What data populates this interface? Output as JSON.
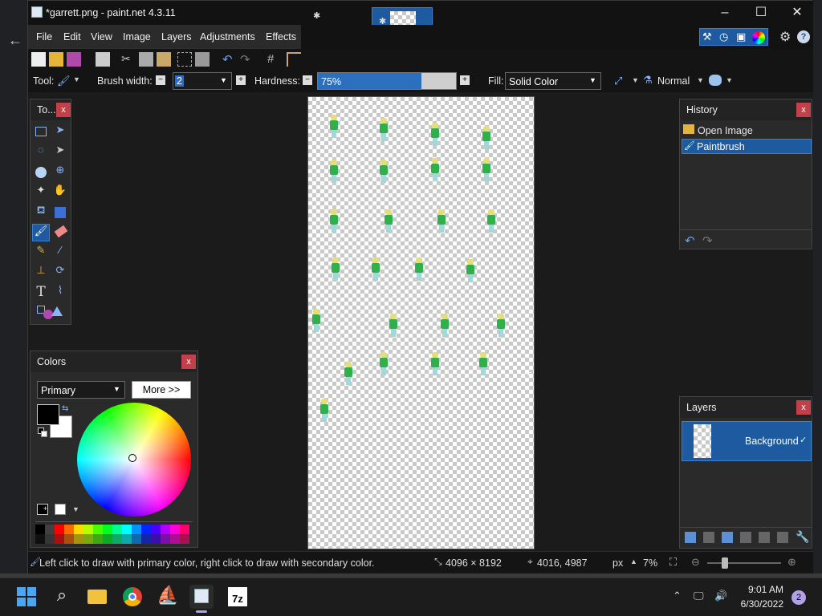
{
  "window": {
    "title": "*garrett.png - paint.net 4.3.11"
  },
  "menu": {
    "items": [
      "File",
      "Edit",
      "View",
      "Image",
      "Layers",
      "Adjustments",
      "Effects"
    ]
  },
  "toolbar": {
    "tool_label": "Tool:",
    "brush_width_label": "Brush width:",
    "brush_width_value": "2",
    "hardness_label": "Hardness:",
    "hardness_value": "75%",
    "hardness_fraction": 0.75,
    "fill_label": "Fill:",
    "fill_value": "Solid Color",
    "blend_mode": "Normal"
  },
  "tools_panel": {
    "title": "To..."
  },
  "colors_panel": {
    "title": "Colors",
    "mode": "Primary",
    "more_button": "More >>",
    "primary_color": "#000000",
    "secondary_color": "#ffffff",
    "palette": [
      "#000000",
      "#404040",
      "#ff0000",
      "#ff6a00",
      "#ffd800",
      "#b6ff00",
      "#4cff00",
      "#00ff21",
      "#00ff90",
      "#00ffff",
      "#0094ff",
      "#0026ff",
      "#4800ff",
      "#b200ff",
      "#ff00dc",
      "#ff006e"
    ]
  },
  "history_panel": {
    "title": "History",
    "items": [
      {
        "label": "Open Image",
        "icon": "folder-icon",
        "selected": false
      },
      {
        "label": "Paintbrush",
        "icon": "paintbrush-icon",
        "selected": true
      }
    ]
  },
  "layers_panel": {
    "title": "Layers",
    "layers": [
      {
        "name": "Background",
        "visible": true
      }
    ]
  },
  "status": {
    "hint": "Left click to draw with primary color, right click to draw with secondary color.",
    "image_size": "4096 × 8192",
    "cursor_pos": "4016, 4987",
    "units": "px",
    "zoom": "7%"
  },
  "clock": {
    "time": "9:01 AM",
    "date": "6/30/2022"
  },
  "notifications": {
    "count": "2"
  },
  "colors": {
    "accent": "#2d6fbf",
    "selection": "#1e5aa0",
    "close": "#c2404a"
  }
}
